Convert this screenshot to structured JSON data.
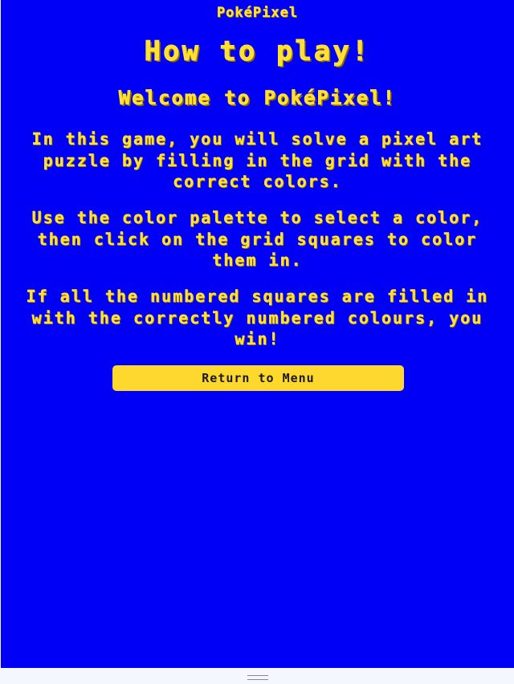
{
  "app": {
    "brand": "PokéPixel"
  },
  "page": {
    "title": "How to play!",
    "subtitle": "Welcome to PokéPixel!",
    "paragraphs": [
      "In this game, you will solve a pixel art puzzle by filling in the grid with the correct colors.",
      "Use the color palette to select a color, then click on the grid squares to color them in.",
      "If all the numbered squares are filled in with the correctly numbered colours, you win!"
    ]
  },
  "actions": {
    "return_label": "Return to Menu"
  },
  "colors": {
    "background": "#0000f6",
    "text": "#ffe033",
    "button": "#ffd82e"
  },
  "icons": {
    "bottom_handle": "drag-handle-icon"
  }
}
